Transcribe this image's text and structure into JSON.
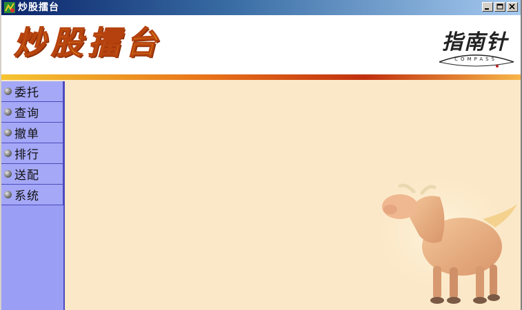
{
  "window": {
    "title": "炒股擂台"
  },
  "banner": {
    "title": "炒股擂台",
    "logo_text": "指南针",
    "logo_subtext": "COMPASS"
  },
  "sidebar": {
    "items": [
      {
        "label": "委托"
      },
      {
        "label": "查询"
      },
      {
        "label": "撤单"
      },
      {
        "label": "排行"
      },
      {
        "label": "送配"
      },
      {
        "label": "系统"
      }
    ]
  },
  "colors": {
    "titlebar_start": "#0a246a",
    "sidebar": "#9b9ef5",
    "content_bg": "#fbe8c8",
    "banner_title": "#f1a51a"
  }
}
